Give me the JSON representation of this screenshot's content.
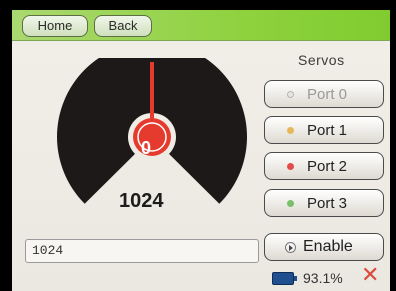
{
  "nav": {
    "home_label": "Home",
    "back_label": "Back"
  },
  "servos": {
    "title": "Servos",
    "ports": [
      {
        "label": "Port 0",
        "dot_color": "#e6e6e6"
      },
      {
        "label": "Port 1",
        "dot_color": "#e5b65a"
      },
      {
        "label": "Port 2",
        "dot_color": "#e24b4b"
      },
      {
        "label": "Port 3",
        "dot_color": "#7ac06a"
      }
    ],
    "enable_label": "Enable"
  },
  "gauge": {
    "value": "1024",
    "knob_value": "0",
    "accent_color": "#e53b2e",
    "fill_color": "#1c1918"
  },
  "input": {
    "value": "1024"
  },
  "status": {
    "battery": "93.1%"
  },
  "colors": {
    "topbar": "#8fd23f",
    "background": "#efebe6"
  }
}
